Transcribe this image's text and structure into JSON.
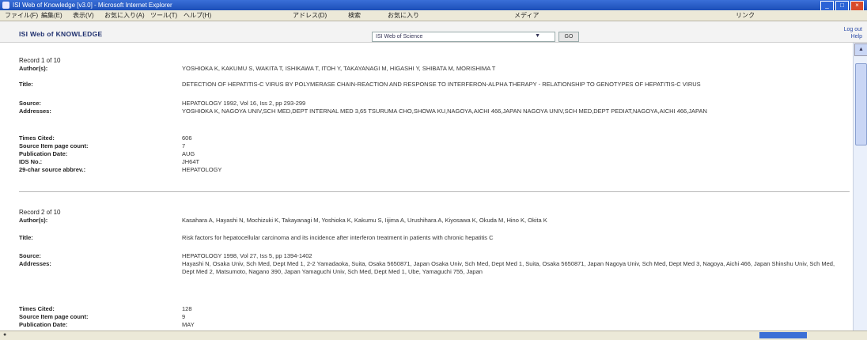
{
  "window": {
    "title": "ISI Web of Knowledge [v3.0] - Microsoft Internet Explorer"
  },
  "menubar": [
    "ファイル(F)",
    "編集(E)",
    "表示(V)",
    "お気に入り(A)",
    "ツール(T)",
    "ヘルプ(H)"
  ],
  "toolbar": [
    "アドレス(D)",
    "検索",
    "お気に入り",
    "メディア",
    "リンク"
  ],
  "header": {
    "logo": "ISI Web of KNOWLEDGE",
    "db_value": "ISI Web of Science",
    "go_label": "GO",
    "logout": "Log out Help"
  },
  "records": [
    {
      "title": "Record 1 of 10",
      "fields": [
        {
          "label": "Author(s):",
          "value": "YOSHIOKA K, KAKUMU S, WAKITA T, ISHIKAWA T, ITOH Y, TAKAYANAGI M, HIGASHI Y, SHIBATA M, MORISHIMA T"
        },
        {
          "label": "Title:",
          "value": "DETECTION OF HEPATITIS-C VIRUS BY POLYMERASE CHAIN-REACTION AND RESPONSE TO INTERFERON-ALPHA THERAPY - RELATIONSHIP TO GENOTYPES OF HEPATITIS-C VIRUS"
        },
        {
          "label": "Source:",
          "value": "HEPATOLOGY 1992, Vol 16, Iss 2, pp 293-299"
        },
        {
          "label": "Addresses:",
          "value": "YOSHIOKA K, NAGOYA UNIV,SCH MED,DEPT INTERNAL MED 3,65 TSURUMA CHO,SHOWA KU,NAGOYA,AICHI 466,JAPAN  NAGOYA UNIV,SCH MED,DEPT PEDIAT,NAGOYA,AICHI 466,JAPAN"
        },
        {
          "label": "Times Cited:",
          "value": "606"
        },
        {
          "label": "Source Item page count:",
          "value": "7"
        },
        {
          "label": "Publication Date:",
          "value": "AUG"
        },
        {
          "label": "IDS No.:",
          "value": "JH64T"
        },
        {
          "label": "29-char source abbrev.:",
          "value": "HEPATOLOGY"
        }
      ]
    },
    {
      "title": "Record 2 of 10",
      "fields": [
        {
          "label": "Author(s):",
          "value": "Kasahara A, Hayashi N, Mochizuki K, Takayanagi M, Yoshioka K, Kakumu S, Iijima A, Urushihara A, Kiyosawa K, Okuda M, Hino K, Okita K"
        },
        {
          "label": "Title:",
          "value": "Risk factors for hepatocellular carcinoma and its incidence after interferon treatment in patients with chronic hepatitis C"
        },
        {
          "label": "Source:",
          "value": "HEPATOLOGY 1998, Vol 27, Iss 5, pp 1394-1402"
        },
        {
          "label": "Addresses:",
          "value": "Hayashi N, Osaka Univ, Sch Med, Dept Med 1, 2-2 Yamadaoka, Suita, Osaka 5650871, Japan  Osaka Univ, Sch Med, Dept Med 1, Suita, Osaka 5650871, Japan  Nagoya Univ, Sch Med, Dept Med 3, Nagoya, Aichi 466, Japan  Shinshu Univ, Sch Med, Dept Med 2, Matsumoto, Nagano 390, Japan  Yamaguchi Univ, Sch Med, Dept Med 1, Ube, Yamaguchi 755, Japan"
        },
        {
          "label": "Times Cited:",
          "value": "128"
        },
        {
          "label": "Source Item page count:",
          "value": "9"
        },
        {
          "label": "Publication Date:",
          "value": "MAY"
        }
      ]
    }
  ]
}
